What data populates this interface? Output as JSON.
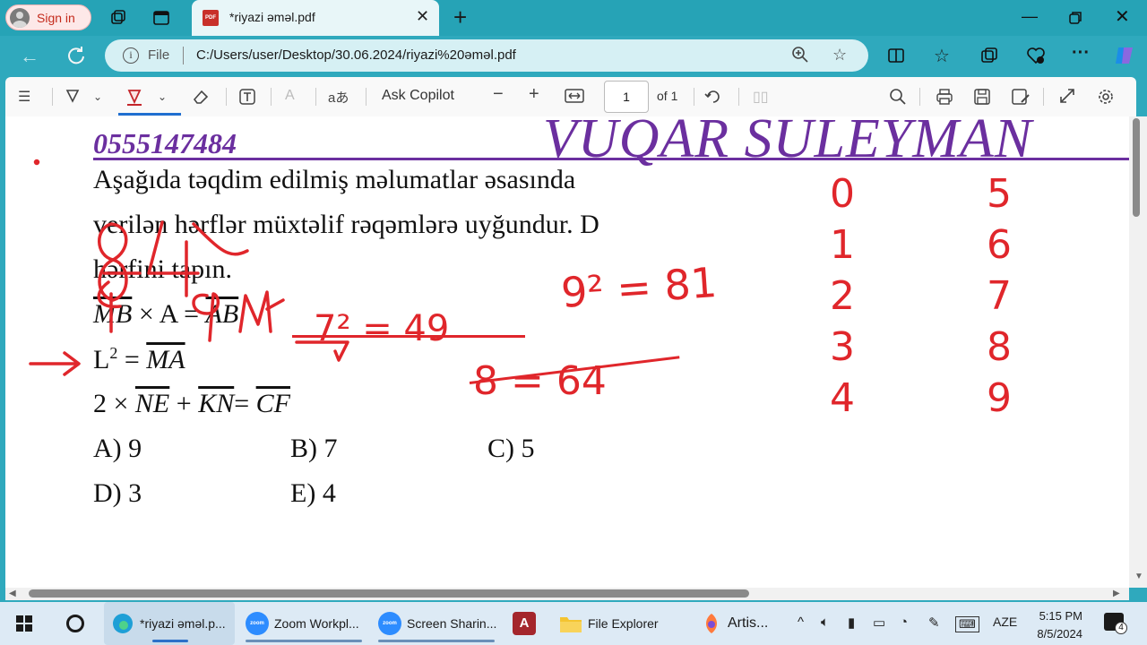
{
  "browser": {
    "signin_label": "Sign in",
    "tab_title": "*riyazi əməl.pdf",
    "tab_icon_text": "PDF",
    "address_prefix": "File",
    "url": "C:/Users/user/Desktop/30.06.2024/riyazi%20əməl.pdf"
  },
  "pdf_toolbar": {
    "ask_copilot": "Ask Copilot",
    "page_number": "1",
    "page_of": "of 1",
    "read_aloud_glyph": "aあ"
  },
  "document": {
    "phone": "0555147484",
    "brand": "VUQAR SÜLEYMAN",
    "question_line1": "Aşağıda təqdim edilmiş məlumatlar əsasında",
    "question_line2": "verilən hərflər müxtəlif rəqəmlərə uyğundur. D",
    "question_line3": "hərfini tapın.",
    "eq1_left": "MB",
    "eq1_op": "× A =",
    "eq1_right": "AB",
    "eq2_left": "L",
    "eq2_sup": "2",
    "eq2_op": "=",
    "eq2_right": "MA",
    "eq3_prefix": "2 ×",
    "eq3_a": "NE",
    "eq3_plus": "+",
    "eq3_b": "KN",
    "eq3_eq": "=",
    "eq3_c": "CF",
    "options": [
      "A) 9",
      "B) 7",
      "C) 5",
      "D) 3",
      "E) 4"
    ]
  },
  "handwriting": {
    "calc1": "9² = 81",
    "calc2": "7² = 49",
    "calc3": "8 = 64",
    "left_col": [
      "0",
      "1",
      "2",
      "3",
      "4"
    ],
    "right_col": [
      "5",
      "6",
      "7",
      "8",
      "9"
    ],
    "ink_color": "#e0262b"
  },
  "taskbar": {
    "items": [
      "*riyazi əməl.p...",
      "Zoom Workpl...",
      "Screen Sharin...",
      "File Explorer",
      "Artis..."
    ],
    "lang": "AZE",
    "time": "5:15 PM",
    "date": "8/5/2024",
    "notif_count": "4",
    "zoom_icon_text": "zoom"
  },
  "colors": {
    "brand_purple": "#6b2f9f",
    "accent_teal": "#2fa9bd",
    "ink_red": "#e0262b"
  }
}
